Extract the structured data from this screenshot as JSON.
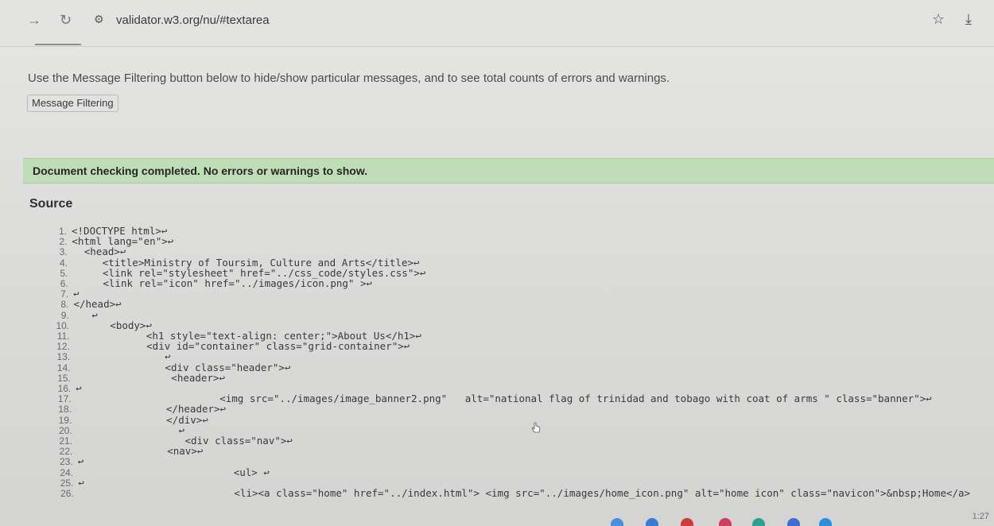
{
  "browser": {
    "url": "validator.w3.org/nu/#textarea",
    "icons": {
      "forward": "forward-arrow-icon",
      "reload": "reload-icon",
      "site_info": "site-info-icon",
      "bookmark": "star-icon",
      "download": "download-icon"
    }
  },
  "page": {
    "help_text": "Use the Message Filtering button below to hide/show particular messages, and to see total counts of errors and warnings.",
    "filter_button": "Message Filtering",
    "status_message": "Document checking completed. No errors or warnings to show.",
    "source_heading": "Source"
  },
  "source_lines": [
    {
      "n": "1.",
      "text": "<!DOCTYPE html>↩"
    },
    {
      "n": "2.",
      "text": "<html lang=\"en\">↩"
    },
    {
      "n": "3.",
      "text": "  <head>↩"
    },
    {
      "n": "4.",
      "text": "     <title>Ministry of Toursim, Culture and Arts</title>↩"
    },
    {
      "n": "5.",
      "text": "     <link rel=\"stylesheet\" href=\"../css_code/styles.css\">↩"
    },
    {
      "n": "6.",
      "text": "     <link rel=\"icon\" href=\"../images/icon.png\" >↩"
    },
    {
      "n": "7.",
      "text": "↩"
    },
    {
      "n": "8.",
      "text": "</head>↩"
    },
    {
      "n": "9.",
      "text": "   ↩"
    },
    {
      "n": "10.",
      "text": "      <body>↩"
    },
    {
      "n": "11.",
      "text": "            <h1 style=\"text-align: center;\">About Us</h1>↩"
    },
    {
      "n": "12.",
      "text": "            <div id=\"container\" class=\"grid-container\">↩"
    },
    {
      "n": "13.",
      "text": "               ↩"
    },
    {
      "n": "14.",
      "text": "               <div class=\"header\">↩"
    },
    {
      "n": "15.",
      "text": "                <header>↩"
    },
    {
      "n": "16.",
      "text": "↩"
    },
    {
      "n": "17.",
      "text": "                        <img src=\"../images/image_banner2.png\"   alt=\"national flag of trinidad and tobago with coat of arms \" class=\"banner\">↩"
    },
    {
      "n": "18.",
      "text": "               </header>↩"
    },
    {
      "n": "19.",
      "text": "               </div>↩"
    },
    {
      "n": "20.",
      "text": "                 ↩"
    },
    {
      "n": "21.",
      "text": "                  <div class=\"nav\">↩"
    },
    {
      "n": "22.",
      "text": "               <nav>↩"
    },
    {
      "n": "23.",
      "text": "↩"
    },
    {
      "n": "24.",
      "text": "                          <ul> ↩"
    },
    {
      "n": "25.",
      "text": "↩"
    },
    {
      "n": "26.",
      "text": "                          <li><a class=\"home\" href=\"../index.html\"> <img src=\"../images/home_icon.png\" alt=\"home icon\" class=\"navicon\">&nbsp;Home</a>"
    }
  ],
  "taskbar": {
    "clock": "1:27"
  },
  "colors": {
    "success_bg": "#c1dcb8",
    "page_bg": "#dcdcda"
  }
}
